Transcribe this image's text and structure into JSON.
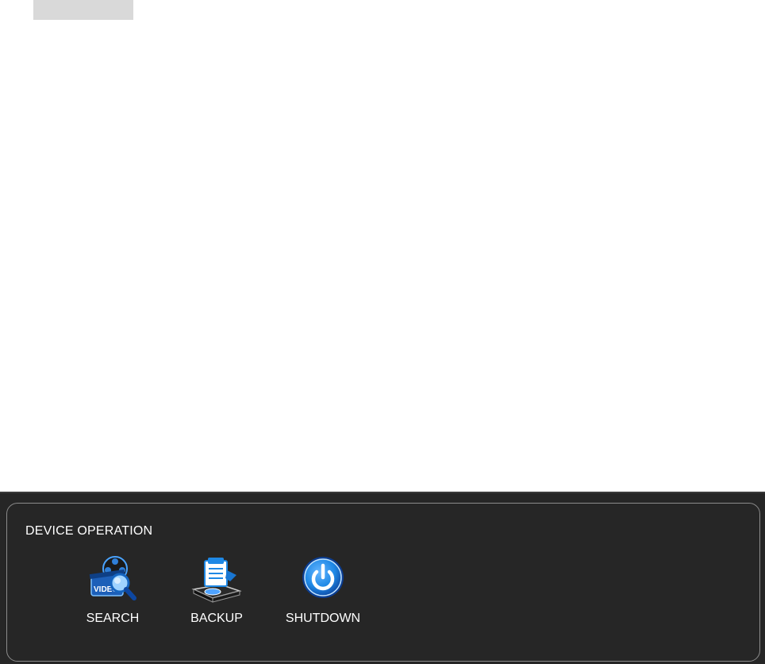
{
  "panel": {
    "title": "DEVICE OPERATION",
    "buttons": [
      {
        "label": "SEARCH",
        "icon": "video-search-icon",
        "icon_text": "VIDEO"
      },
      {
        "label": "BACKUP",
        "icon": "backup-drive-icon"
      },
      {
        "label": "SHUTDOWN",
        "icon": "power-icon"
      }
    ]
  },
  "colors": {
    "panel_background": "#262626",
    "frame_border": "#8c8c8c",
    "accent_blue": "#1e88e5",
    "tab_stub": "#d9d9d9"
  }
}
